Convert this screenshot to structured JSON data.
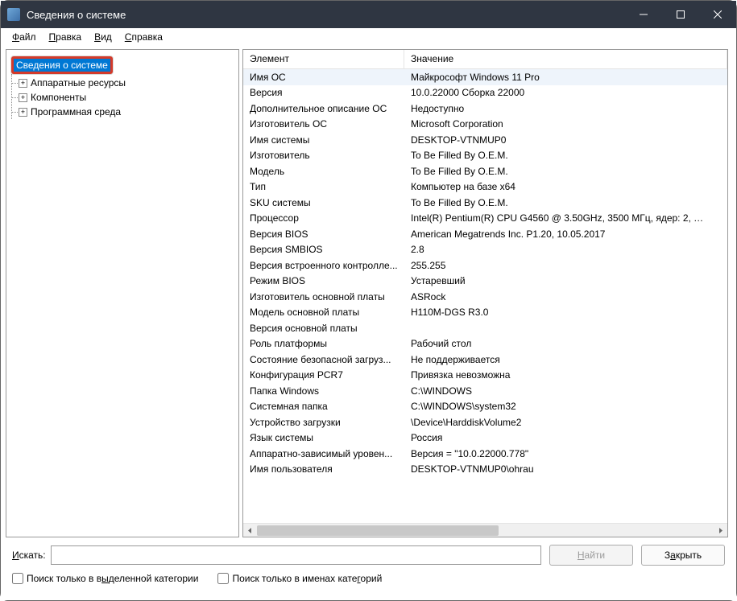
{
  "window": {
    "title": "Сведения о системе"
  },
  "menu": {
    "file": "Файл",
    "edit": "Правка",
    "view": "Вид",
    "help": "Справка"
  },
  "tree": {
    "root": "Сведения о системе",
    "hardware": "Аппаратные ресурсы",
    "components": "Компоненты",
    "software": "Программная среда"
  },
  "columns": {
    "element": "Элемент",
    "value": "Значение"
  },
  "rows": [
    {
      "k": "Имя ОС",
      "v": "Майкрософт Windows 11 Pro",
      "hl": true
    },
    {
      "k": "Версия",
      "v": "10.0.22000 Сборка 22000"
    },
    {
      "k": "Дополнительное описание ОС",
      "v": "Недоступно"
    },
    {
      "k": "Изготовитель ОС",
      "v": "Microsoft Corporation"
    },
    {
      "k": "Имя системы",
      "v": "DESKTOP-VTNMUP0"
    },
    {
      "k": "Изготовитель",
      "v": "To Be Filled By O.E.M."
    },
    {
      "k": "Модель",
      "v": "To Be Filled By O.E.M."
    },
    {
      "k": "Тип",
      "v": "Компьютер на базе x64"
    },
    {
      "k": "SKU системы",
      "v": "To Be Filled By O.E.M."
    },
    {
      "k": "Процессор",
      "v": "Intel(R) Pentium(R) CPU G4560 @ 3.50GHz, 3500 МГц, ядер: 2, …"
    },
    {
      "k": "Версия BIOS",
      "v": "American Megatrends Inc. P1.20, 10.05.2017"
    },
    {
      "k": "Версия SMBIOS",
      "v": "2.8"
    },
    {
      "k": "Версия встроенного контролле...",
      "v": "255.255"
    },
    {
      "k": "Режим BIOS",
      "v": "Устаревший"
    },
    {
      "k": "Изготовитель основной платы",
      "v": "ASRock"
    },
    {
      "k": "Модель основной платы",
      "v": "H110M-DGS R3.0"
    },
    {
      "k": "Версия основной платы",
      "v": ""
    },
    {
      "k": "Роль платформы",
      "v": "Рабочий стол"
    },
    {
      "k": "Состояние безопасной загруз...",
      "v": "Не поддерживается"
    },
    {
      "k": "Конфигурация PCR7",
      "v": "Привязка невозможна"
    },
    {
      "k": "Папка Windows",
      "v": "C:\\WINDOWS"
    },
    {
      "k": "Системная папка",
      "v": "C:\\WINDOWS\\system32"
    },
    {
      "k": "Устройство загрузки",
      "v": "\\Device\\HarddiskVolume2"
    },
    {
      "k": "Язык системы",
      "v": "Россия"
    },
    {
      "k": "Аппаратно-зависимый уровен...",
      "v": "Версия = \"10.0.22000.778\""
    },
    {
      "k": "Имя пользователя",
      "v": "DESKTOP-VTNMUP0\\ohrau"
    }
  ],
  "bottom": {
    "search_label": "Искать:",
    "find_btn": "Найти",
    "close_btn": "Закрыть",
    "chk_category": "Поиск только в выделенной категории",
    "chk_names": "Поиск только в именах категорий"
  }
}
